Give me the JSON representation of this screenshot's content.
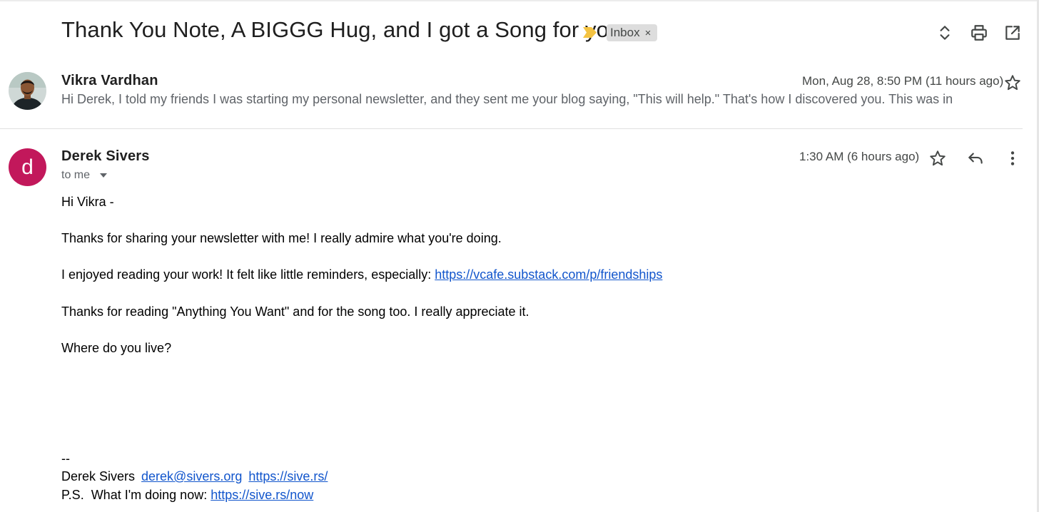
{
  "thread": {
    "subject": "Thank You Note, A BIGGG Hug, and I got a Song for you",
    "label": "Inbox",
    "label_remove": "×"
  },
  "message1": {
    "sender": "Vikra Vardhan",
    "date": "Mon, Aug 28, 8:50 PM (11 hours ago)",
    "snippet": "Hi Derek, I told my friends I was starting my personal newsletter, and they sent me your blog saying, \"This will help.\" That's how I discovered you. This was in"
  },
  "message2": {
    "avatar_letter": "d",
    "sender": "Derek Sivers",
    "recipient": "to me",
    "date": "1:30 AM (6 hours ago)",
    "greeting": "Hi Vikra -",
    "para1": "Thanks for sharing your newsletter with me! I really admire what you're doing.",
    "para2_text": "I enjoyed reading your work! It felt like little reminders, especially: ",
    "para2_link": "https://vcafe.substack.com/p/friendships",
    "para3": "Thanks for reading \"Anything You Want\" and for the song too. I really appreciate it.",
    "para4": "Where do you live?",
    "sig_dash": "--",
    "sig_name": "Derek Sivers",
    "sig_email": "derek@sivers.org",
    "sig_site": "https://sive.rs/",
    "sig_ps": "P.S.  What I'm doing now: ",
    "sig_now_link": "https://sive.rs/now"
  },
  "icons": {
    "importance": "importance-marker-icon",
    "expand": "expand-all-icon",
    "print": "print-icon",
    "popout": "open-in-new-window-icon",
    "star": "star-icon",
    "reply": "reply-icon",
    "more": "more-vert-icon"
  },
  "colors": {
    "importance_marker": "#f4c342",
    "avatar_d": "#c2185b",
    "link": "#1155cc",
    "chip_bg": "#dddddd"
  }
}
